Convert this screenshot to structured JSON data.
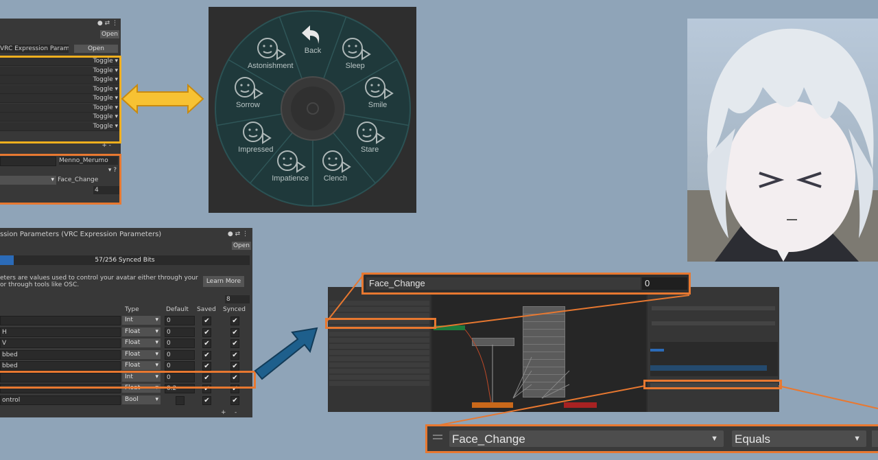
{
  "top_panel": {
    "open_label": "Open",
    "params_label": "VRC Expression Parameters",
    "params_open": "Open",
    "toggle_label": "Toggle",
    "toggle_count": 8,
    "param_field": "Menno_Merumo",
    "param_name": "Face_Change",
    "value": "4"
  },
  "radial_menu": {
    "items": [
      {
        "label": "Back",
        "icon": "back-arrow-icon"
      },
      {
        "label": "Sleep",
        "icon": "sleep-face-icon"
      },
      {
        "label": "Smile",
        "icon": "smile-face-icon"
      },
      {
        "label": "Stare",
        "icon": "stare-face-icon"
      },
      {
        "label": "Clench",
        "icon": "clench-face-icon"
      },
      {
        "label": "Impatience",
        "icon": "impatience-face-icon"
      },
      {
        "label": "Impressed",
        "icon": "impressed-face-icon"
      },
      {
        "label": "Sorrow",
        "icon": "sorrow-face-icon"
      },
      {
        "label": "Astonishment",
        "icon": "astonishment-face-icon"
      }
    ]
  },
  "params_panel": {
    "title": "ssion Parameters (VRC Expression Parameters)",
    "open_label": "Open",
    "bits_label": "57/256 Synced Bits",
    "bits_fraction": 0.22,
    "desc_line1": "eters are values used to control your avatar either through your",
    "desc_line2": "or through tools like OSC.",
    "learn_more": "Learn More",
    "count": "8",
    "headers": {
      "type": "Type",
      "default": "Default",
      "saved": "Saved",
      "synced": "Synced"
    },
    "rows": [
      {
        "name": "",
        "type": "Int",
        "default": "0",
        "saved": true,
        "synced": true
      },
      {
        "name": "H",
        "type": "Float",
        "default": "0",
        "saved": true,
        "synced": true
      },
      {
        "name": "V",
        "type": "Float",
        "default": "0",
        "saved": true,
        "synced": true
      },
      {
        "name": "bbed",
        "type": "Float",
        "default": "0",
        "saved": true,
        "synced": true
      },
      {
        "name": "bbed",
        "type": "Float",
        "default": "0",
        "saved": true,
        "synced": true
      },
      {
        "name": "",
        "type": "Int",
        "default": "0",
        "saved": true,
        "synced": true
      },
      {
        "name": "",
        "type": "Float",
        "default": "0.2",
        "saved": true,
        "synced": true
      },
      {
        "name": "ontrol",
        "type": "Bool",
        "default": "",
        "saved": true,
        "synced": true
      }
    ],
    "add": "+",
    "remove": "-"
  },
  "animator": {
    "param_name": "Face_Change",
    "param_value": "0"
  },
  "condition": {
    "param": "Face_Change",
    "op": "Equals"
  },
  "colors": {
    "highlight_yellow": "#f2b01e",
    "highlight_orange": "#e87830",
    "arrow_blue": "#1e5f8c",
    "menu_teal": "#1e3a3c"
  }
}
